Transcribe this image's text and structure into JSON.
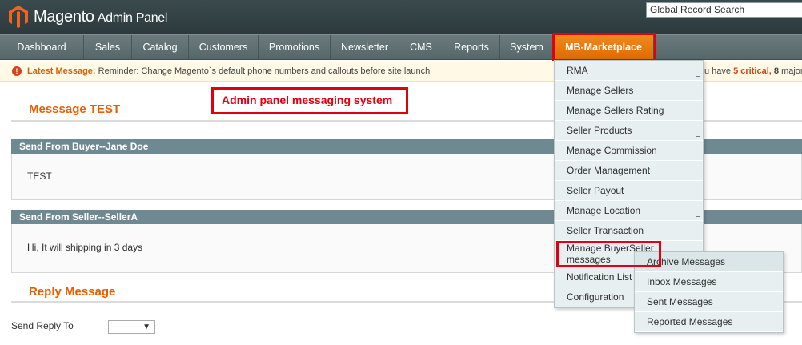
{
  "header": {
    "logo_brand": "Magento",
    "logo_suffix": "Admin Panel",
    "search_placeholder": "Global Record Search"
  },
  "nav": {
    "items": [
      "Dashboard",
      "Sales",
      "Catalog",
      "Customers",
      "Promotions",
      "Newsletter",
      "CMS",
      "Reports",
      "System",
      "MB-Marketplace"
    ],
    "active": "MB-Marketplace"
  },
  "notice": {
    "label": "Latest Message:",
    "text": "Reminder: Change Magento`s default phone numbers and callouts before site launch",
    "right_prefix": "u have",
    "critical_count": "5",
    "critical_label": "critical,",
    "major_count": "8",
    "major_label": "major,"
  },
  "annotation": "Admin panel messaging system",
  "content": {
    "title": "Messsage TEST",
    "buyer_header": "Send From Buyer--Jane Doe",
    "buyer_message": "TEST",
    "seller_header": "Send From Seller--SellerA",
    "seller_message": "Hi, It will shipping in 3 days",
    "reply_title": "Reply Message",
    "reply_label": "Send Reply To",
    "reply_select_arrow": "▼"
  },
  "dropdown": {
    "items": [
      {
        "label": "RMA",
        "has_sub": true
      },
      {
        "label": "Manage Sellers",
        "has_sub": false
      },
      {
        "label": "Manage Sellers Rating",
        "has_sub": false
      },
      {
        "label": "Seller Products",
        "has_sub": true
      },
      {
        "label": "Manage Commission",
        "has_sub": false
      },
      {
        "label": "Order Management",
        "has_sub": false
      },
      {
        "label": "Seller Payout",
        "has_sub": false
      },
      {
        "label": "Manage Location",
        "has_sub": true
      },
      {
        "label": "Seller Transaction",
        "has_sub": false
      },
      {
        "label": "Manage BuyerSeller messages",
        "has_sub": false
      },
      {
        "label": "Notification List",
        "has_sub": false
      },
      {
        "label": "Configuration",
        "has_sub": false
      }
    ]
  },
  "submenu": {
    "items": [
      "Archive Messages",
      "Inbox Messages",
      "Sent Messages",
      "Reported Messages"
    ]
  },
  "colors": {
    "accent_orange": "#eb5e00",
    "nav_active": "#f08a1e",
    "highlight_red": "#e1000f",
    "section_header": "#6f8992"
  }
}
